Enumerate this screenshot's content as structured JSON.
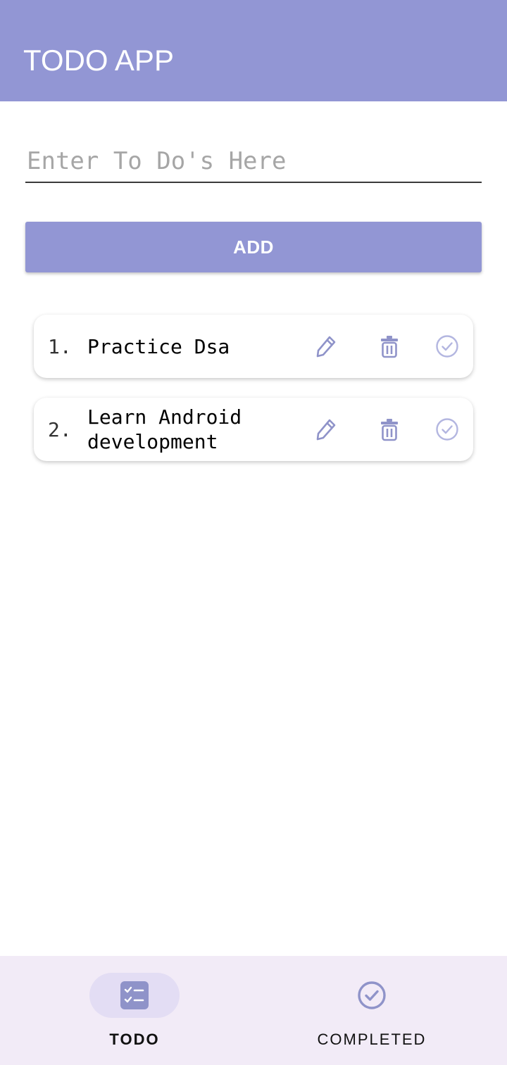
{
  "app_bar": {
    "title": "TODO APP"
  },
  "input": {
    "value": "",
    "placeholder": "Enter To Do's Here"
  },
  "add_button": {
    "label": "ADD"
  },
  "todos": [
    {
      "number": "1.",
      "text": "Practice Dsa"
    },
    {
      "number": "2.",
      "text": "Learn Android development"
    }
  ],
  "bottom_nav": {
    "items": [
      {
        "label": "TODO",
        "icon": "checklist-icon",
        "selected": true
      },
      {
        "label": "COMPLETED",
        "icon": "check-circle-icon",
        "selected": false
      }
    ]
  },
  "colors": {
    "primary": "#9296d4",
    "nav_background": "#f2ebf7",
    "nav_pill": "#e3ddf4",
    "icon": "#8f93c9",
    "check_icon": "#b3b6e0"
  }
}
